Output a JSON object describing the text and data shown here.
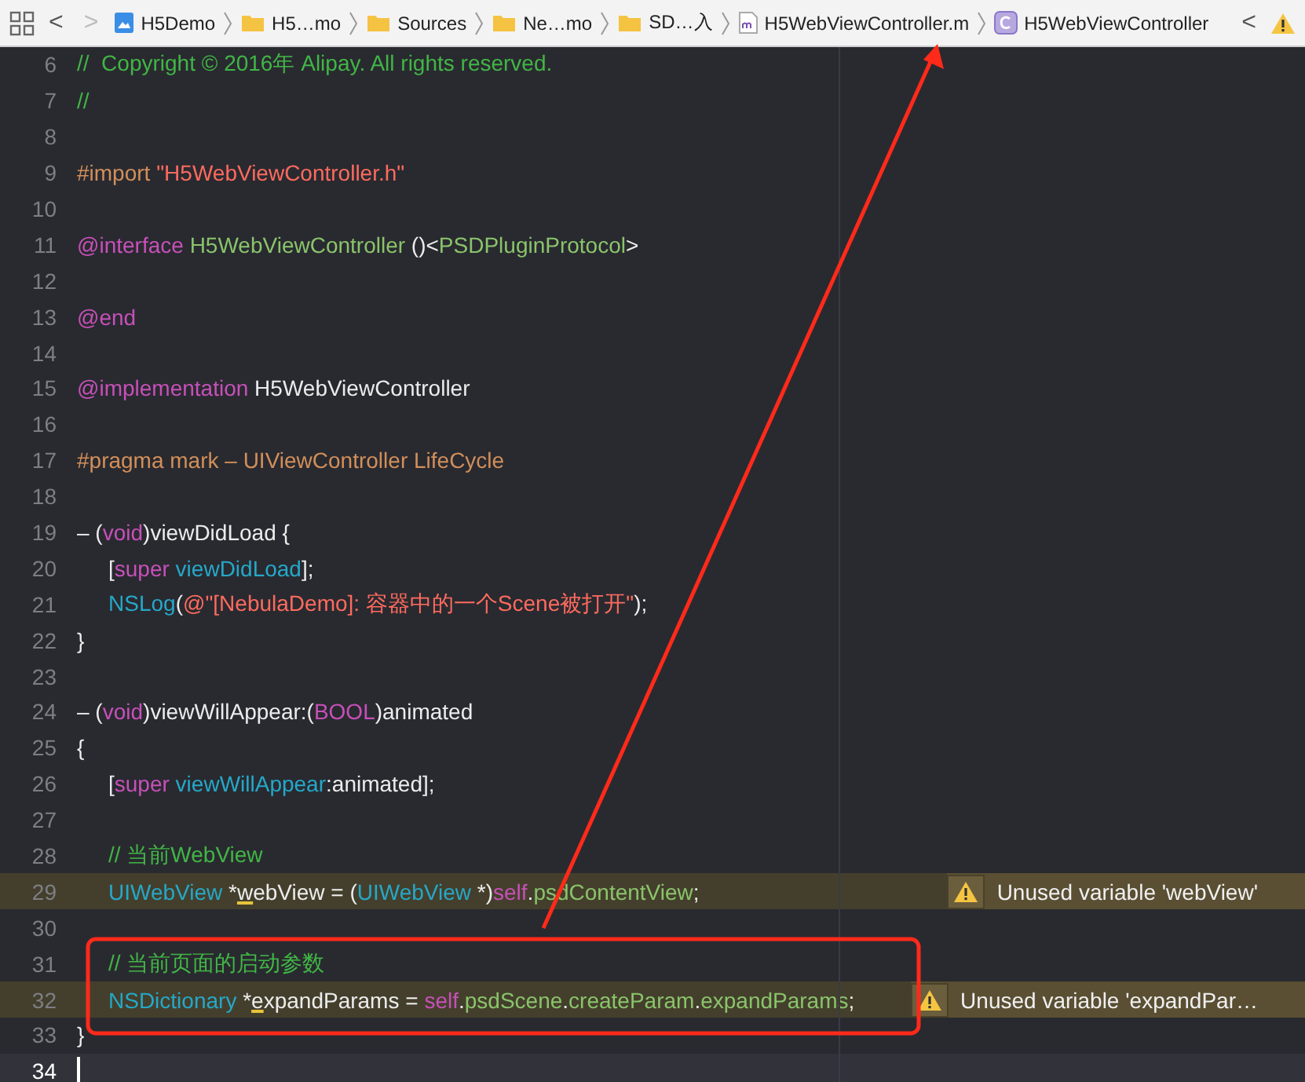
{
  "toolbar": {
    "back": "<",
    "forward": ">",
    "breadcrumbs": [
      {
        "label": "H5Demo",
        "kind": "project"
      },
      {
        "label": "H5…mo",
        "kind": "folder"
      },
      {
        "label": "Sources",
        "kind": "folder"
      },
      {
        "label": "Ne…mo",
        "kind": "folder"
      },
      {
        "label": "SD…入",
        "kind": "folder"
      },
      {
        "label": "H5WebViewController.m",
        "kind": "file"
      },
      {
        "label": "H5WebViewController",
        "kind": "class"
      }
    ],
    "issue_back": "<"
  },
  "editor": {
    "lines": [
      {
        "number": "6",
        "tokens": [
          {
            "text": "//  Copyright © 2016年 Alipay. All rights reserved.",
            "kind": "comment"
          }
        ]
      },
      {
        "number": "7",
        "tokens": [
          {
            "text": "//",
            "kind": "comment"
          }
        ]
      },
      {
        "number": "8"
      },
      {
        "number": "9",
        "tokens": [
          {
            "text": "#import ",
            "kind": "preprocessor"
          },
          {
            "text": "\"H5WebViewController.h\"",
            "kind": "string"
          }
        ]
      },
      {
        "number": "10"
      },
      {
        "number": "11",
        "tokens": [
          {
            "text": "@interface ",
            "kind": "keyword"
          },
          {
            "text": "H5WebViewController",
            "kind": "project"
          },
          {
            "text": " ()<",
            "kind": "plain"
          },
          {
            "text": "PSDPluginProtocol",
            "kind": "project"
          },
          {
            "text": ">",
            "kind": "plain"
          }
        ]
      },
      {
        "number": "12"
      },
      {
        "number": "13",
        "tokens": [
          {
            "text": "@end",
            "kind": "keyword"
          }
        ]
      },
      {
        "number": "14"
      },
      {
        "number": "15",
        "tokens": [
          {
            "text": "@implementation ",
            "kind": "keyword"
          },
          {
            "text": "H5WebViewController",
            "kind": "plain"
          }
        ]
      },
      {
        "number": "16"
      },
      {
        "number": "17",
        "tokens": [
          {
            "text": "#pragma mark – UIViewController LifeCycle",
            "kind": "preprocessor"
          }
        ]
      },
      {
        "number": "18"
      },
      {
        "number": "19",
        "tokens": [
          {
            "text": "– (",
            "kind": "plain"
          },
          {
            "text": "void",
            "kind": "keyword"
          },
          {
            "text": ")viewDidLoad {",
            "kind": "plain"
          }
        ]
      },
      {
        "number": "20",
        "indented": true,
        "tokens": [
          {
            "text": "[",
            "kind": "plain"
          },
          {
            "text": "super",
            "kind": "keyword"
          },
          {
            "text": " viewDidLoad",
            "kind": "type"
          },
          {
            "text": "];",
            "kind": "plain"
          }
        ]
      },
      {
        "number": "21",
        "indented": true,
        "tokens": [
          {
            "text": "NSLog",
            "kind": "type"
          },
          {
            "text": "(",
            "kind": "plain"
          },
          {
            "text": "@\"[NebulaDemo]: 容器中的一个Scene被打开\"",
            "kind": "string"
          },
          {
            "text": ");",
            "kind": "plain"
          }
        ]
      },
      {
        "number": "22",
        "tokens": [
          {
            "text": "}",
            "kind": "plain"
          }
        ]
      },
      {
        "number": "23"
      },
      {
        "number": "24",
        "tokens": [
          {
            "text": "– (",
            "kind": "plain"
          },
          {
            "text": "void",
            "kind": "keyword"
          },
          {
            "text": ")viewWillAppear:(",
            "kind": "plain"
          },
          {
            "text": "BOOL",
            "kind": "keyword"
          },
          {
            "text": ")animated",
            "kind": "plain"
          }
        ]
      },
      {
        "number": "25",
        "tokens": [
          {
            "text": "{",
            "kind": "plain"
          }
        ]
      },
      {
        "number": "26",
        "indented": true,
        "tokens": [
          {
            "text": "[",
            "kind": "plain"
          },
          {
            "text": "super",
            "kind": "keyword"
          },
          {
            "text": " viewWillAppear",
            "kind": "type"
          },
          {
            "text": ":animated];",
            "kind": "plain"
          }
        ]
      },
      {
        "number": "27"
      },
      {
        "number": "28",
        "indented": true,
        "tokens": [
          {
            "text": "// 当前WebView",
            "kind": "comment"
          }
        ]
      },
      {
        "number": "29",
        "indented": true,
        "warning": "Unused variable 'webView'",
        "tokens": [
          {
            "text": "UIWebView",
            "kind": "type"
          },
          {
            "text": " *",
            "kind": "plain"
          },
          {
            "text": "w",
            "kind": "flagged"
          },
          {
            "text": "ebView = (",
            "kind": "plain"
          },
          {
            "text": "UIWebView",
            "kind": "type"
          },
          {
            "text": " *)",
            "kind": "plain"
          },
          {
            "text": "self",
            "kind": "keyword"
          },
          {
            "text": ".",
            "kind": "plain"
          },
          {
            "text": "psdContentView",
            "kind": "project"
          },
          {
            "text": ";",
            "kind": "plain"
          }
        ]
      },
      {
        "number": "30"
      },
      {
        "number": "31",
        "indented": true,
        "tokens": [
          {
            "text": "// 当前页面的启动参数",
            "kind": "comment"
          }
        ]
      },
      {
        "number": "32",
        "indented": true,
        "warning": "Unused variable 'expandPar…",
        "tokens": [
          {
            "text": "NSDictionary",
            "kind": "type"
          },
          {
            "text": " *",
            "kind": "plain"
          },
          {
            "text": "e",
            "kind": "flagged"
          },
          {
            "text": "xpandParams = ",
            "kind": "plain"
          },
          {
            "text": "self",
            "kind": "keyword"
          },
          {
            "text": ".",
            "kind": "plain"
          },
          {
            "text": "psdScene",
            "kind": "project"
          },
          {
            "text": ".",
            "kind": "plain"
          },
          {
            "text": "createParam",
            "kind": "project"
          },
          {
            "text": ".",
            "kind": "plain"
          },
          {
            "text": "expandParams",
            "kind": "project"
          },
          {
            "text": ";",
            "kind": "plain"
          }
        ]
      },
      {
        "number": "33",
        "tokens": [
          {
            "text": "}",
            "kind": "plain"
          }
        ]
      },
      {
        "number": "34",
        "current": true
      }
    ]
  }
}
